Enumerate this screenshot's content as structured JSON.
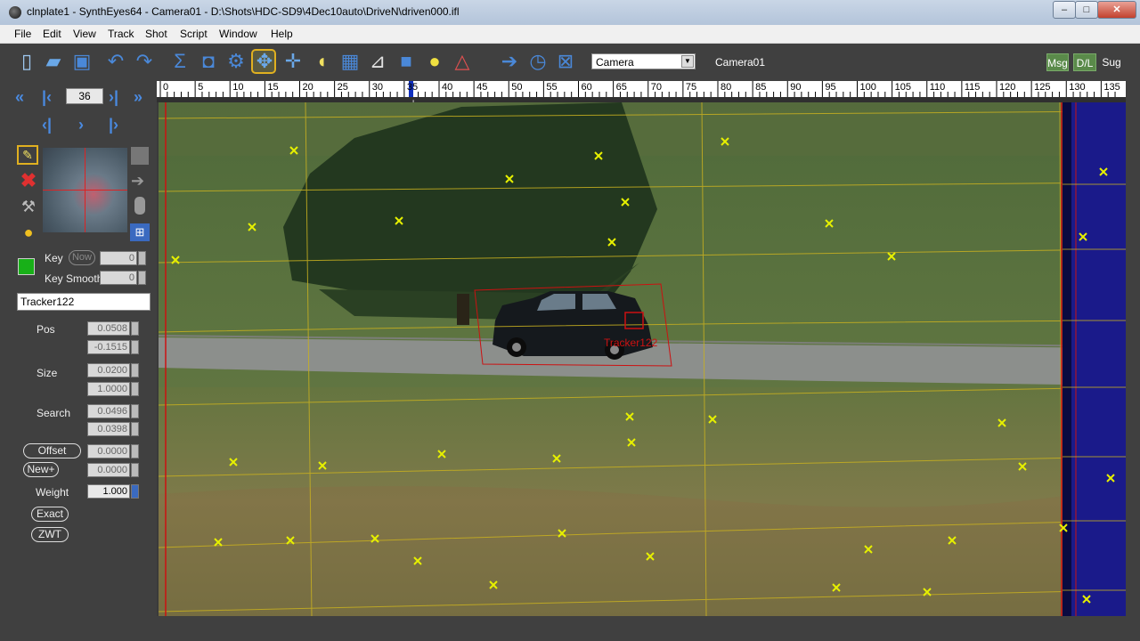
{
  "window": {
    "title": "clnplate1 - SynthEyes64 - Camera01 - D:\\Shots\\HDC-SD9\\4Dec10auto\\DriveN\\driven000.ifl"
  },
  "menu": [
    "File",
    "Edit",
    "View",
    "Track",
    "Shot",
    "Script",
    "Window",
    "Help"
  ],
  "toolbar": {
    "camera_select": "Camera",
    "camera_label": "Camera01",
    "right_buttons": [
      "Msg",
      "D/L",
      "Sug"
    ]
  },
  "frame": {
    "current": "36"
  },
  "timeline": {
    "labels": [
      "0",
      "5",
      "10",
      "15",
      "20",
      "25",
      "30",
      "35",
      "40",
      "45",
      "50",
      "55",
      "60",
      "65",
      "70",
      "75",
      "80",
      "85",
      "90",
      "95",
      "100",
      "105",
      "110",
      "115",
      "120",
      "125",
      "130",
      "135"
    ]
  },
  "panel": {
    "key_label": "Key",
    "now_label": "Now",
    "key_value": "0",
    "key_smooth_label": "Key Smooth",
    "key_smooth_value": "0",
    "tracker_name": "Tracker122",
    "pos_label": "Pos",
    "pos_x": "0.0508",
    "pos_y": "-0.1515",
    "size_label": "Size",
    "size_w": "0.0200",
    "size_h": "1.0000",
    "search_label": "Search",
    "search_w": "0.0496",
    "search_h": "0.0398",
    "offset_label": "Offset",
    "offset_value": "0.0000",
    "newplus_label": "New+",
    "newplus_value": "0.0000",
    "weight_label": "Weight",
    "weight_value": "1.000",
    "exact_label": "Exact",
    "zwt_label": "ZWT"
  },
  "viewport": {
    "tracker_label": "Tracker122"
  },
  "colors": {
    "tracker_marker": "#e6f000",
    "selected_box": "#cc1111",
    "grid": "#c8b020",
    "right_band": "#1a1a8a"
  }
}
